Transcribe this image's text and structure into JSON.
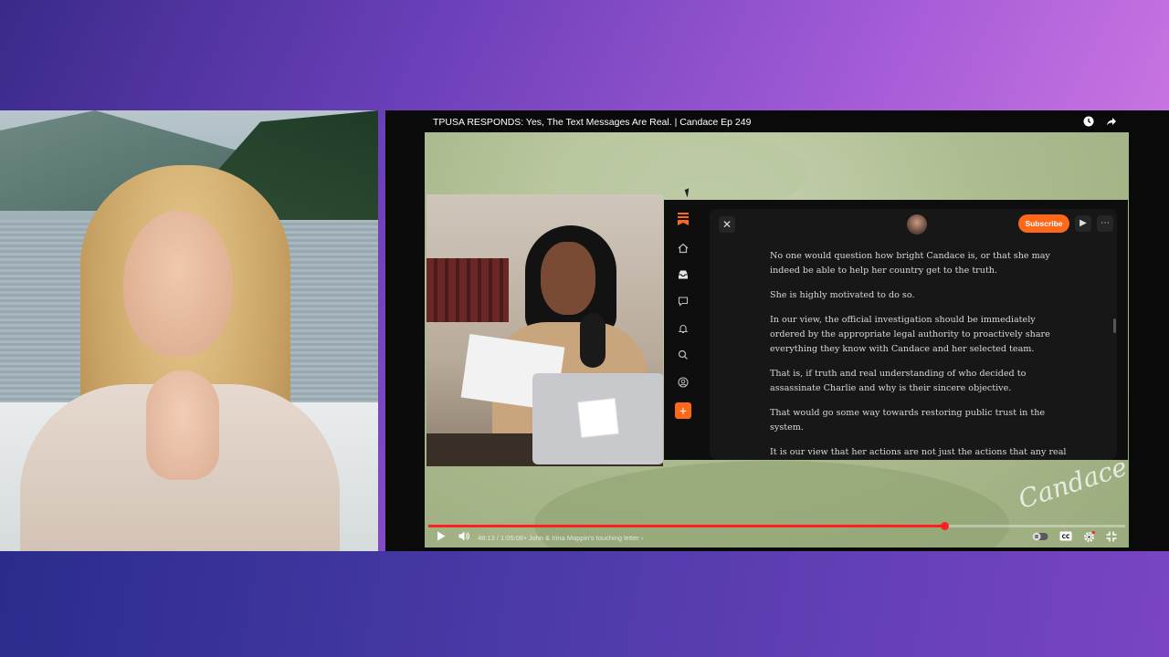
{
  "player": {
    "title": "TPUSA RESPONDS: Yes, The Text Messages Are Real. | Candace Ep 249",
    "watch_later_icon": "clock-icon",
    "share_icon": "share-icon",
    "time": "48:13 / 1:05:08",
    "chapter": "• John & Irina Mappin's touching letter",
    "chapter_chevron": "›",
    "progress": 0.741,
    "accent": "#ff1f1f"
  },
  "watermark": {
    "text": "Candace"
  },
  "substack": {
    "accent": "#ff6719",
    "subscribe_label": "Subscribe",
    "sidebar": [
      "home-icon",
      "inbox-icon",
      "chat-icon",
      "bell-icon",
      "search-icon",
      "profile-icon",
      "add-icon"
    ],
    "article": [
      "No one would question how bright Candace is, or that she may indeed be able to help her country get to the truth.",
      "She is highly motivated to do so.",
      "In our view, the official investigation should be immediately ordered by the appropriate legal authority to proactively share everything they know with Candace and her selected team.",
      "That is, if truth and real understanding of who decided to assassinate Charlie and why is their sincere objective.",
      "That would go some way towards restoring public trust in the system.",
      "It is our view that her actions are not just the actions that any real friend would take for their friend."
    ]
  }
}
